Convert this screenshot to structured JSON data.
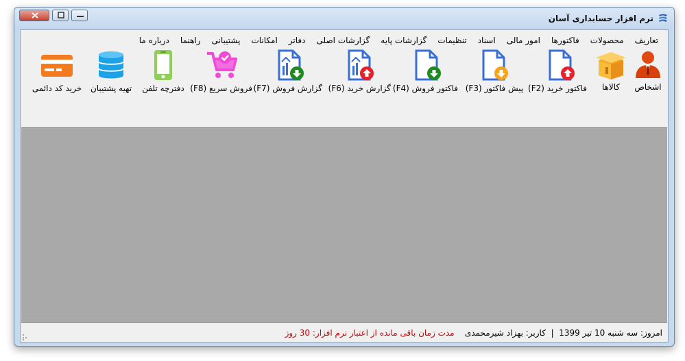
{
  "window": {
    "title": "نرم افزار حسابداری آسان"
  },
  "menu": [
    "تعاریف",
    "محصولات",
    "فاکتورها",
    "امور مالی",
    "اسناد",
    "تنظیمات",
    "گزارشات پایه",
    "گزارشات اصلی",
    "دفاتر",
    "امکانات",
    "پشتیبانی",
    "راهنما",
    "درباره ما"
  ],
  "toolbar": {
    "persons": "اشخاص",
    "goods": "کالاها",
    "purchase_invoice": "فاکتور خرید (F2)",
    "pre_invoice": "پیش فاکتور (F3)",
    "sales_invoice": "فاکتور فروش (F4)",
    "purchase_report": "گزارش خرید (F6)",
    "sales_report": "گزارش فروش (F7)",
    "quick_sale": "فروش سریع (F8)",
    "phonebook": "دفترچه تلفن",
    "backup": "تهیه پشتیبان",
    "buy_code": "خرید کد دائمی"
  },
  "status": {
    "today": "امروز: سه شنبه 10 تیر 1399",
    "divider": "|",
    "user": "کاربر: بهزاد شیرمحمدی",
    "remaining": "مدت زمان باقی مانده از اعتبار نرم افزار: 30 روز"
  },
  "colors": {
    "accent_red": "#e8202a",
    "accent_green": "#1f8a1f",
    "accent_blue": "#3a6fd6",
    "workspace": "#a9a9a9"
  }
}
